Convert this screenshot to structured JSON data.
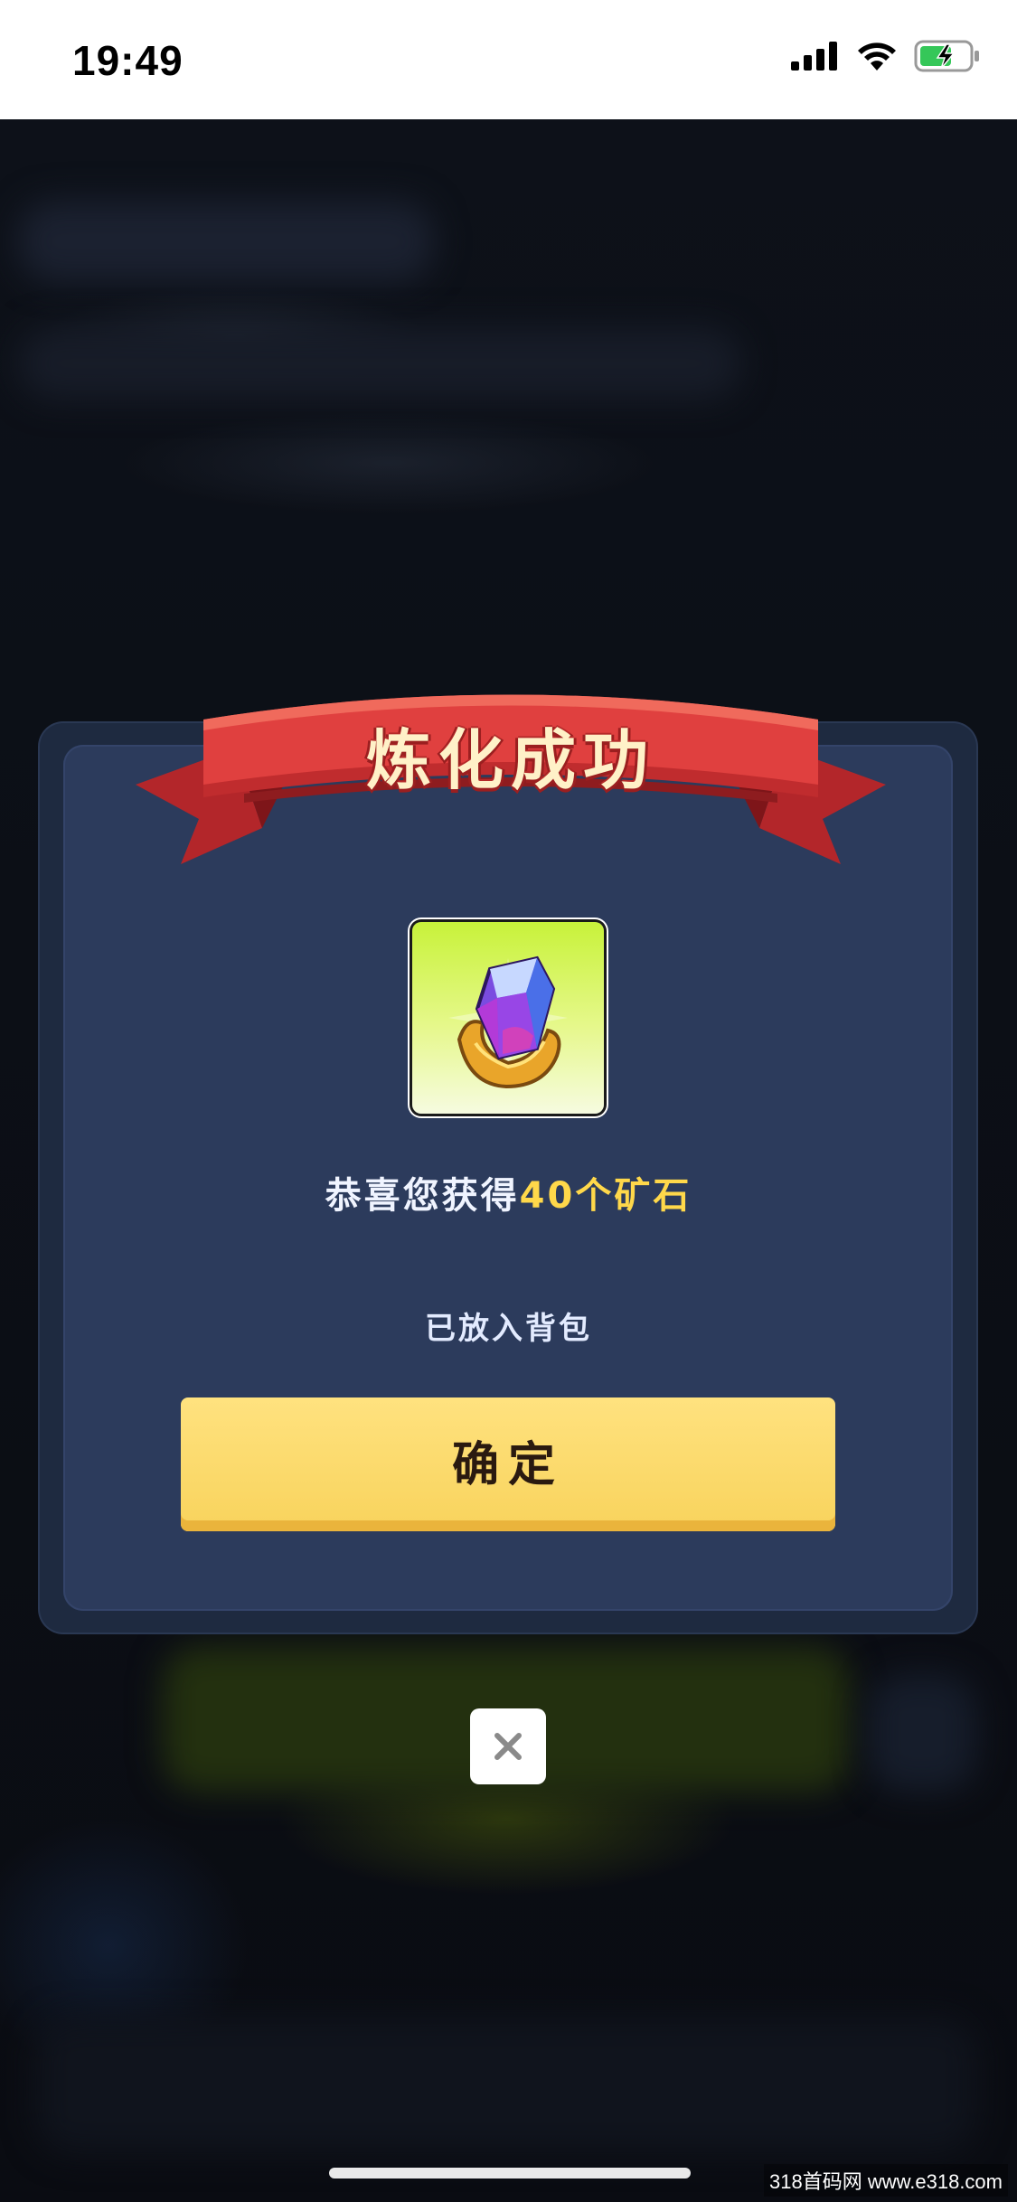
{
  "status_bar": {
    "time": "19:49",
    "icons": [
      "cellular-signal-icon",
      "wifi-icon",
      "battery-charging-icon"
    ]
  },
  "dialog": {
    "title": "炼化成功",
    "reward_item": {
      "icon": "crystal-ore-icon"
    },
    "message_prefix": "恭喜您获得",
    "message_reward": "40个矿石",
    "placed_text": "已放入背包",
    "confirm_label": "确定"
  },
  "close": {
    "icon": "close-icon"
  },
  "watermark": "318首码网 www.e318.com",
  "colors": {
    "dialog_bg": "#2c3b5c",
    "ribbon_red": "#d8373a",
    "title_text": "#fff1c8",
    "reward_gold": "#ffd84a",
    "button_yellow": "#f8d35c"
  }
}
